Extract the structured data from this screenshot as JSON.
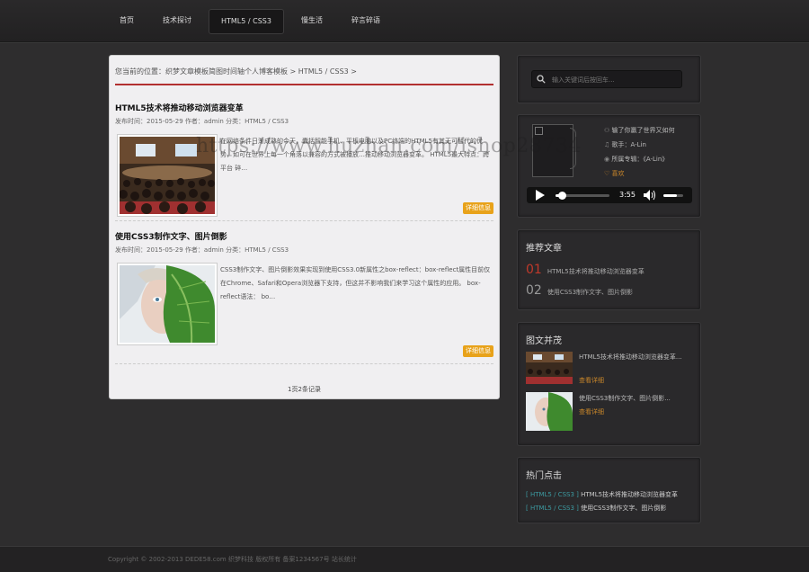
{
  "nav": {
    "items": [
      "首页",
      "技术探讨",
      "HTML5 / CSS3",
      "慢生活",
      "碎言碎语"
    ],
    "active_index": 2
  },
  "breadcrumb": {
    "prefix": "您当前的位置：",
    "path": "织梦文章模板简图时间轴个人博客模板 > HTML5 / CSS3 >"
  },
  "articles": [
    {
      "title": "HTML5技术将推动移动浏览器变革",
      "meta": "发布时间：2015-05-29  作者：admin  分类：HTML5 / CSS3",
      "text": "在网络条件日渐成熟的今天，囊括智能手机、平板电脑以及PC终端的HTML5有其无可替代的优势，如可在世界上每一个角落以兼容的方式被播放…推动移动浏览器变革。 HTML5最大特点：跨平台 碎…",
      "more": "详细信息"
    },
    {
      "title": "使用CSS3制作文字、图片倒影",
      "meta": "发布时间：2015-05-29  作者：admin  分类：HTML5 / CSS3",
      "text": "CSS3制作文字、图片倒影效果实现到使用CSS3.0新属性之box-reflect：box-reflect属性目前仅在Chrome、Safari和Opera浏览器下支持，但这并不影响我们来学习这个属性的应用。 box-reflect语法： bo…",
      "more": "详细信息"
    }
  ],
  "pager": "1页2条记录",
  "search": {
    "placeholder": "输入关键词后按回车..."
  },
  "player": {
    "song": "输了你赢了世界又如何",
    "singer": "歌手：A-Lin",
    "album": "所属专辑：《A-Lin》",
    "like": "喜欢",
    "time": "3:55",
    "progress": 0.12,
    "volume": 0.7
  },
  "recommend": {
    "title": "推荐文章",
    "items": [
      {
        "num": "01",
        "text": "HTML5技术将推动移动浏览器变革",
        "color": "#c0392b"
      },
      {
        "num": "02",
        "text": "使用CSS3制作文字、图片倒影",
        "color": "#999999"
      }
    ]
  },
  "picks": {
    "title": "图文并茂",
    "items": [
      {
        "title": "HTML5技术将推动移动浏览器变革...",
        "link": "查看详细"
      },
      {
        "title": "使用CSS3制作文字、图片倒影...",
        "link": "查看详细"
      }
    ]
  },
  "hot": {
    "title": "热门点击",
    "items": [
      {
        "cat": "[ HTML5 / CSS3 ]",
        "text": "HTML5技术将推动移动浏览器变革"
      },
      {
        "cat": "[ HTML5 / CSS3 ]",
        "text": "使用CSS3制作文字、图片倒影"
      }
    ]
  },
  "footer": "Copyright © 2002-2013 DEDE58.com 织梦科技 版权所有 备案1234567号 站长统计",
  "watermark": "https://www.huzhan.com/ishop28734",
  "colors": {
    "accent_red": "#b23030",
    "button_orange": "#e8a21a",
    "link_orange": "#c8862a",
    "hot_cat": "#3c9aa0"
  }
}
